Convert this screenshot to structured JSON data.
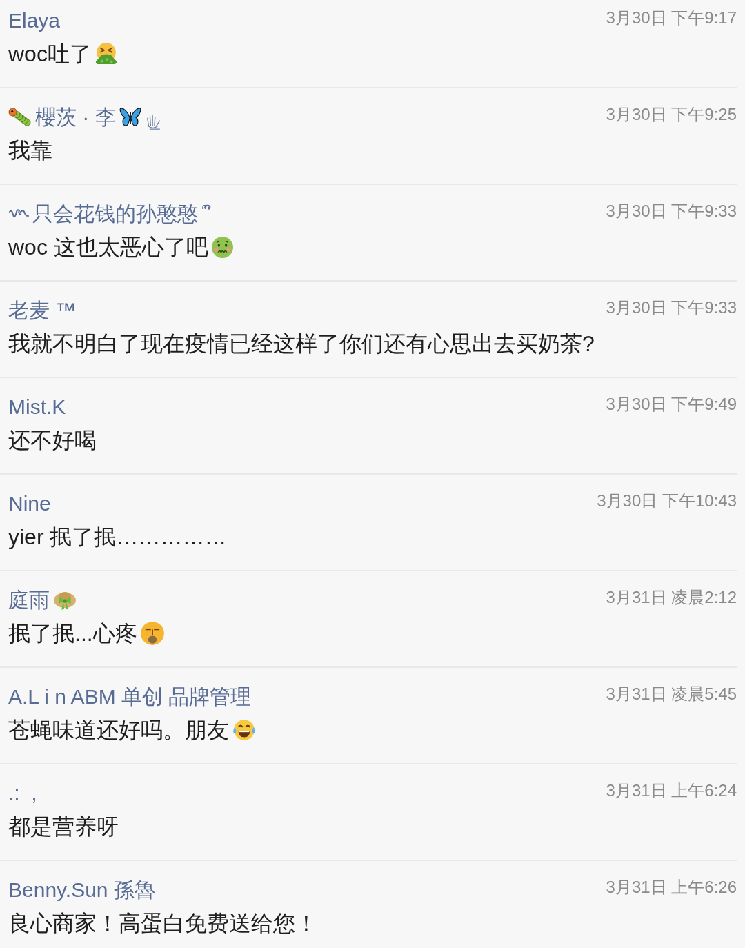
{
  "comments": [
    {
      "author": "Elaya",
      "time": "3月30日 下午9:17",
      "message": "woc吐了"
    },
    {
      "author": "櫻茨 · 李",
      "time": "3月30日 下午9:25",
      "message": "我靠"
    },
    {
      "author": "只会花钱的孙憨憨",
      "time": "3月30日 下午9:33",
      "message": "woc 这也太恶心了吧"
    },
    {
      "author": "老麦 ™",
      "time": "3月30日 下午9:33",
      "message": "我就不明白了现在疫情已经这样了你们还有心思出去买奶茶?"
    },
    {
      "author": "Mist.K",
      "time": "3月30日 下午9:49",
      "message": "还不好喝"
    },
    {
      "author": "Nine",
      "time": "3月30日 下午10:43",
      "message": "yier 抿了抿……………"
    },
    {
      "author": "庭雨",
      "time": "3月31日 凌晨2:12",
      "message": "抿了抿...心疼"
    },
    {
      "author": "A.L i n ABM 单创 品牌管理",
      "time": "3月31日 凌晨5:45",
      "message": "苍蝇味道还好吗。朋友"
    },
    {
      "author": ".:  ,",
      "time": "3月31日 上午6:24",
      "message": "都是营养呀"
    },
    {
      "author": "Benny.Sun 孫魯",
      "time": "3月31日 上午6:26",
      "message": "良心商家！高蛋白免费送给您！"
    }
  ]
}
